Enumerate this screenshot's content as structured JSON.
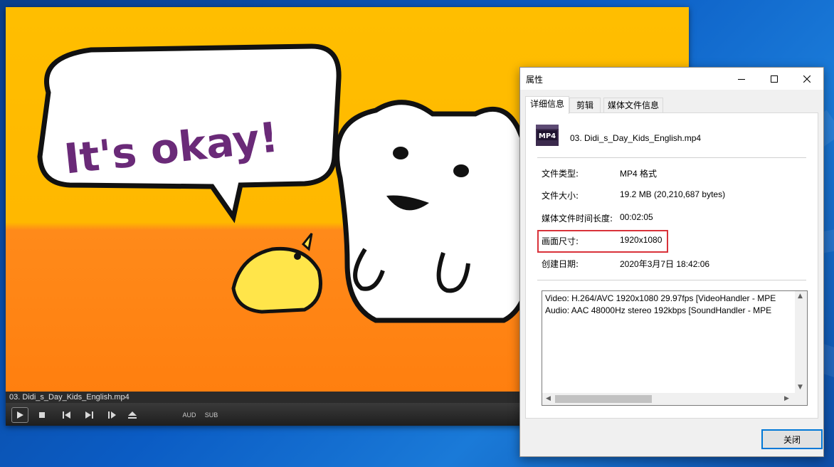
{
  "player": {
    "filename": "03. Didi_s_Day_Kids_English.mp4",
    "video_text": "It's okay!",
    "controls": {
      "aud_label": "AUD",
      "sub_label": "SUB"
    }
  },
  "dialog": {
    "title": "属性",
    "tabs": [
      {
        "label": "详细信息",
        "active": true
      },
      {
        "label": "剪辑",
        "active": false
      },
      {
        "label": "媒体文件信息",
        "active": false
      }
    ],
    "file_icon_label": "MP4",
    "filename": "03. Didi_s_Day_Kids_English.mp4",
    "properties": [
      {
        "label": "文件类型:",
        "value": "MP4 格式"
      },
      {
        "label": "文件大小:",
        "value": "19.2 MB (20,210,687 bytes)"
      },
      {
        "label": "媒体文件时间长度:",
        "value": "00:02:05"
      },
      {
        "label": "画面尺寸:",
        "value": "1920x1080"
      },
      {
        "label": "创建日期:",
        "value": "2020年3月7日 18:42:06"
      }
    ],
    "stream_info": [
      "Video: H.264/AVC 1920x1080 29.97fps [VideoHandler - MPE",
      "Audio: AAC 48000Hz stereo 192kbps [SoundHandler - MPE"
    ],
    "close_label": "关闭",
    "highlight_color": "#d9323a",
    "accent_color": "#0078d7"
  }
}
